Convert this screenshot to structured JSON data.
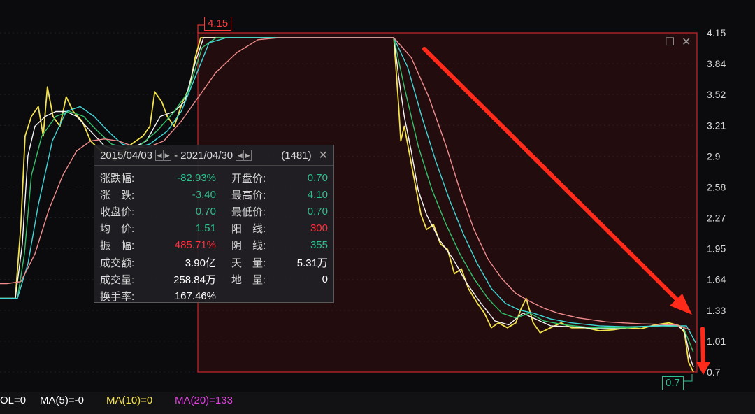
{
  "chart_data": {
    "type": "line",
    "y_ticks": [
      "4.15",
      "3.84",
      "3.52",
      "3.21",
      "2.9",
      "2.58",
      "2.27",
      "1.95",
      "1.64",
      "1.33",
      "1.01",
      "0.7"
    ],
    "ylim": [
      0.7,
      4.15
    ],
    "x_range": [
      0,
      1000
    ],
    "high_marker": "4.15",
    "low_marker": "0.7",
    "series": [
      {
        "color": "#f3e24a",
        "values": [
          [
            0,
            1.45
          ],
          [
            22,
            1.45
          ],
          [
            30,
            2.2
          ],
          [
            36,
            3.1
          ],
          [
            45,
            3.3
          ],
          [
            55,
            3.4
          ],
          [
            62,
            3.1
          ],
          [
            68,
            3.6
          ],
          [
            76,
            3.3
          ],
          [
            86,
            3.2
          ],
          [
            95,
            3.5
          ],
          [
            105,
            3.35
          ],
          [
            118,
            3.25
          ],
          [
            130,
            3.05
          ],
          [
            145,
            2.95
          ],
          [
            165,
            2.85
          ],
          [
            185,
            3.0
          ],
          [
            205,
            3.1
          ],
          [
            215,
            3.2
          ],
          [
            222,
            3.55
          ],
          [
            232,
            3.45
          ],
          [
            240,
            3.3
          ],
          [
            250,
            3.2
          ],
          [
            262,
            3.45
          ],
          [
            272,
            3.6
          ],
          [
            280,
            3.9
          ],
          [
            288,
            4.1
          ],
          [
            565,
            4.1
          ],
          [
            568,
            3.8
          ],
          [
            572,
            3.4
          ],
          [
            575,
            3.05
          ],
          [
            580,
            3.2
          ],
          [
            588,
            2.9
          ],
          [
            596,
            2.6
          ],
          [
            604,
            2.3
          ],
          [
            612,
            2.15
          ],
          [
            622,
            2.2
          ],
          [
            632,
            2.0
          ],
          [
            642,
            1.95
          ],
          [
            652,
            1.7
          ],
          [
            662,
            1.75
          ],
          [
            672,
            1.55
          ],
          [
            685,
            1.4
          ],
          [
            695,
            1.3
          ],
          [
            705,
            1.15
          ],
          [
            715,
            1.2
          ],
          [
            728,
            1.15
          ],
          [
            740,
            1.2
          ],
          [
            748,
            1.35
          ],
          [
            755,
            1.45
          ],
          [
            765,
            1.2
          ],
          [
            775,
            1.1
          ],
          [
            790,
            1.15
          ],
          [
            805,
            1.2
          ],
          [
            820,
            1.15
          ],
          [
            840,
            1.15
          ],
          [
            860,
            1.12
          ],
          [
            880,
            1.13
          ],
          [
            900,
            1.15
          ],
          [
            920,
            1.14
          ],
          [
            940,
            1.18
          ],
          [
            960,
            1.2
          ],
          [
            975,
            1.17
          ],
          [
            982,
            1.1
          ],
          [
            988,
            0.8
          ],
          [
            995,
            0.7
          ]
        ]
      },
      {
        "color": "#f6f6f6",
        "values": [
          [
            0,
            1.45
          ],
          [
            22,
            1.45
          ],
          [
            32,
            2.0
          ],
          [
            40,
            2.9
          ],
          [
            50,
            3.2
          ],
          [
            65,
            3.3
          ],
          [
            80,
            3.35
          ],
          [
            95,
            3.35
          ],
          [
            110,
            3.3
          ],
          [
            130,
            3.15
          ],
          [
            150,
            3.0
          ],
          [
            170,
            2.95
          ],
          [
            190,
            2.98
          ],
          [
            210,
            3.05
          ],
          [
            230,
            3.3
          ],
          [
            250,
            3.35
          ],
          [
            265,
            3.45
          ],
          [
            280,
            3.85
          ],
          [
            292,
            4.1
          ],
          [
            565,
            4.1
          ],
          [
            572,
            3.7
          ],
          [
            580,
            3.3
          ],
          [
            590,
            2.95
          ],
          [
            600,
            2.55
          ],
          [
            612,
            2.3
          ],
          [
            630,
            2.05
          ],
          [
            650,
            1.85
          ],
          [
            670,
            1.6
          ],
          [
            690,
            1.4
          ],
          [
            710,
            1.22
          ],
          [
            730,
            1.18
          ],
          [
            750,
            1.3
          ],
          [
            765,
            1.25
          ],
          [
            790,
            1.17
          ],
          [
            820,
            1.16
          ],
          [
            860,
            1.14
          ],
          [
            900,
            1.15
          ],
          [
            940,
            1.17
          ],
          [
            970,
            1.18
          ],
          [
            982,
            1.12
          ],
          [
            990,
            0.85
          ],
          [
            995,
            0.75
          ]
        ]
      },
      {
        "color": "#33c26a",
        "values": [
          [
            0,
            1.45
          ],
          [
            25,
            1.45
          ],
          [
            35,
            1.9
          ],
          [
            45,
            2.7
          ],
          [
            60,
            3.1
          ],
          [
            80,
            3.3
          ],
          [
            100,
            3.35
          ],
          [
            120,
            3.3
          ],
          [
            140,
            3.15
          ],
          [
            160,
            3.02
          ],
          [
            180,
            2.98
          ],
          [
            200,
            3.0
          ],
          [
            225,
            3.15
          ],
          [
            250,
            3.35
          ],
          [
            270,
            3.55
          ],
          [
            290,
            4.0
          ],
          [
            310,
            4.1
          ],
          [
            565,
            4.1
          ],
          [
            580,
            3.6
          ],
          [
            600,
            3.0
          ],
          [
            620,
            2.55
          ],
          [
            640,
            2.2
          ],
          [
            660,
            1.9
          ],
          [
            680,
            1.65
          ],
          [
            700,
            1.45
          ],
          [
            720,
            1.3
          ],
          [
            740,
            1.25
          ],
          [
            760,
            1.3
          ],
          [
            780,
            1.22
          ],
          [
            810,
            1.18
          ],
          [
            850,
            1.15
          ],
          [
            900,
            1.15
          ],
          [
            950,
            1.17
          ],
          [
            980,
            1.16
          ],
          [
            995,
            0.9
          ]
        ]
      },
      {
        "color": "#3fd6d6",
        "values": [
          [
            0,
            1.45
          ],
          [
            25,
            1.45
          ],
          [
            40,
            1.8
          ],
          [
            55,
            2.4
          ],
          [
            75,
            3.05
          ],
          [
            95,
            3.35
          ],
          [
            115,
            3.4
          ],
          [
            135,
            3.3
          ],
          [
            155,
            3.15
          ],
          [
            175,
            3.02
          ],
          [
            195,
            2.98
          ],
          [
            215,
            3.02
          ],
          [
            240,
            3.15
          ],
          [
            260,
            3.35
          ],
          [
            280,
            3.7
          ],
          [
            300,
            4.05
          ],
          [
            325,
            4.1
          ],
          [
            565,
            4.1
          ],
          [
            585,
            3.8
          ],
          [
            605,
            3.3
          ],
          [
            625,
            2.85
          ],
          [
            645,
            2.45
          ],
          [
            665,
            2.1
          ],
          [
            685,
            1.8
          ],
          [
            705,
            1.55
          ],
          [
            725,
            1.4
          ],
          [
            745,
            1.33
          ],
          [
            765,
            1.3
          ],
          [
            790,
            1.24
          ],
          [
            820,
            1.2
          ],
          [
            860,
            1.17
          ],
          [
            900,
            1.16
          ],
          [
            950,
            1.17
          ],
          [
            985,
            1.17
          ],
          [
            998,
            1.0
          ]
        ]
      },
      {
        "color": "#f08c8c",
        "values": [
          [
            0,
            1.6
          ],
          [
            10,
            1.6
          ],
          [
            30,
            1.62
          ],
          [
            50,
            1.9
          ],
          [
            70,
            2.35
          ],
          [
            90,
            2.7
          ],
          [
            110,
            2.95
          ],
          [
            130,
            3.05
          ],
          [
            150,
            3.07
          ],
          [
            170,
            3.05
          ],
          [
            190,
            3.0
          ],
          [
            210,
            2.98
          ],
          [
            235,
            3.05
          ],
          [
            260,
            3.25
          ],
          [
            285,
            3.5
          ],
          [
            310,
            3.75
          ],
          [
            340,
            3.95
          ],
          [
            370,
            4.08
          ],
          [
            400,
            4.1
          ],
          [
            565,
            4.1
          ],
          [
            590,
            3.9
          ],
          [
            615,
            3.5
          ],
          [
            640,
            3.0
          ],
          [
            660,
            2.55
          ],
          [
            680,
            2.15
          ],
          [
            700,
            1.85
          ],
          [
            720,
            1.65
          ],
          [
            740,
            1.5
          ],
          [
            760,
            1.42
          ],
          [
            780,
            1.35
          ],
          [
            800,
            1.3
          ],
          [
            830,
            1.25
          ],
          [
            870,
            1.21
          ],
          [
            920,
            1.19
          ],
          [
            970,
            1.18
          ],
          [
            990,
            1.13
          ]
        ]
      }
    ]
  },
  "popup": {
    "date_from": "2015/04/03",
    "date_to": "2021/04/30",
    "count": "(1481)",
    "rows": [
      {
        "l_label": "涨跌幅:",
        "l_value": "-82.93%",
        "l_color": "green",
        "r_label": "开盘价:",
        "r_value": "0.70",
        "r_color": "green"
      },
      {
        "l_label": "涨　跌:",
        "l_value": "-3.40",
        "l_color": "green",
        "r_label": "最高价:",
        "r_value": "4.10",
        "r_color": "green"
      },
      {
        "l_label": "收盘价:",
        "l_value": "0.70",
        "l_color": "green",
        "r_label": "最低价:",
        "r_value": "0.70",
        "r_color": "green"
      },
      {
        "l_label": "均　价:",
        "l_value": "1.51",
        "l_color": "green",
        "r_label": "阳　线:",
        "r_value": "300",
        "r_color": "red"
      },
      {
        "l_label": "振　幅:",
        "l_value": "485.71%",
        "l_color": "red",
        "r_label": "阴　线:",
        "r_value": "355",
        "r_color": "green"
      },
      {
        "l_label": "成交额:",
        "l_value": "3.90亿",
        "l_color": "white",
        "r_label": "天　量:",
        "r_value": "5.31万",
        "r_color": "white"
      },
      {
        "l_label": "成交量:",
        "l_value": "258.84万",
        "l_color": "white",
        "r_label": "地　量:",
        "r_value": "0",
        "r_color": "white"
      },
      {
        "l_label": "换手率:",
        "l_value": "167.46%",
        "l_color": "white",
        "r_label": "",
        "r_value": "",
        "r_color": "white"
      }
    ]
  },
  "indicators": [
    {
      "text": "OL=0",
      "color": "#ffffff"
    },
    {
      "text": "MA(5)=-0",
      "color": "#ffffff"
    },
    {
      "text": "MA(10)=0",
      "color": "#f3e24a"
    },
    {
      "text": "MA(20)=133",
      "color": "#e040e0"
    }
  ]
}
